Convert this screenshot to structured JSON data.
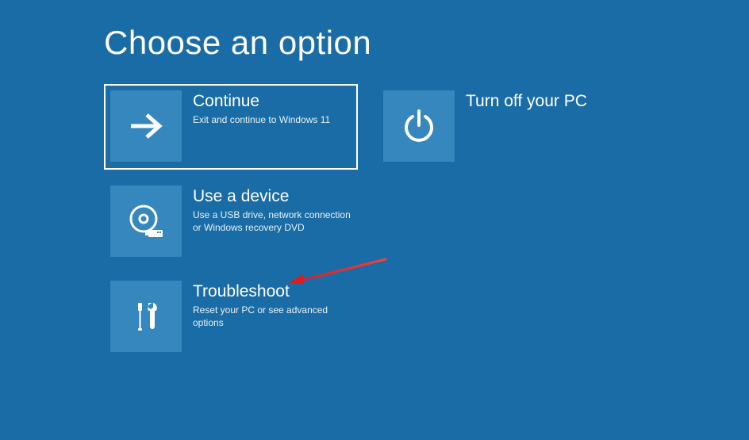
{
  "page_title": "Choose an option",
  "options": {
    "continue": {
      "title": "Continue",
      "desc": "Exit and continue to Windows 11",
      "icon": "arrow-right-icon",
      "selected": true
    },
    "turn_off": {
      "title": "Turn off your PC",
      "desc": "",
      "icon": "power-icon",
      "selected": false
    },
    "use_device": {
      "title": "Use a device",
      "desc": "Use a USB drive, network connection or Windows recovery DVD",
      "icon": "disc-usb-icon",
      "selected": false
    },
    "troubleshoot": {
      "title": "Troubleshoot",
      "desc": "Reset your PC or see advanced options",
      "icon": "tools-icon",
      "selected": false
    }
  },
  "colors": {
    "background": "#1a6ca6",
    "tile": "#3587bd",
    "text": "#ffffff",
    "annotation_arrow": "#e11b1b"
  }
}
